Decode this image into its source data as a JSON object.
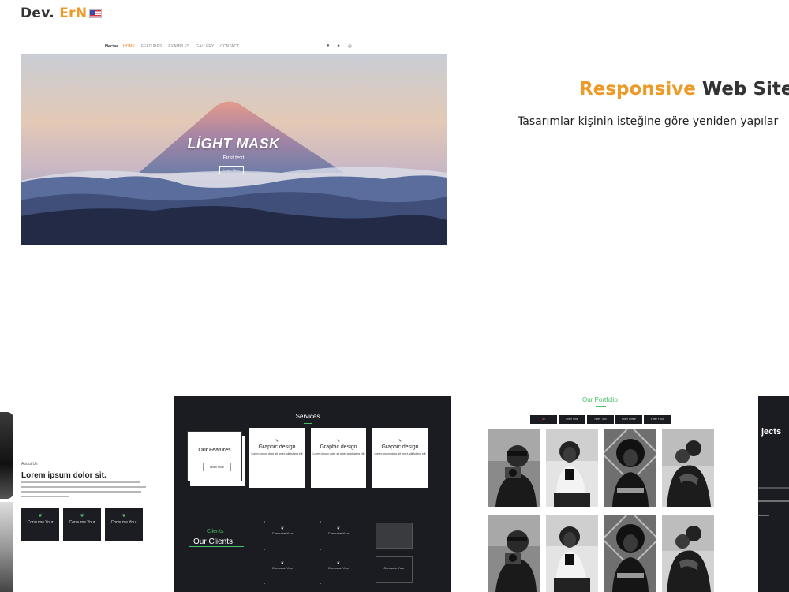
{
  "brand": {
    "prefix": "Dev.",
    "accent": "ErN"
  },
  "language_flag": "us-flag-icon",
  "hero_preview": {
    "nav_brand": "Nectar",
    "nav_items": [
      "HOME",
      "FEATURES",
      "EXAMPLES",
      "GALLERY",
      "CONTACT"
    ],
    "social_icons": [
      "facebook-icon",
      "twitter-icon",
      "instagram-icon"
    ],
    "social_glyphs": [
      "●",
      "✦",
      "◎"
    ],
    "title": "LİGHT MASK",
    "subtitle": "First text",
    "button": "Learn More"
  },
  "headline": {
    "accent": "Responsive",
    "rest": "Web Sitesi",
    "subtitle": "Tasarımlar kişinin isteğine göre yeniden yapılar"
  },
  "about_preview": {
    "small": "About Us",
    "title": "Lorem ipsum dolor sit.",
    "boxes": [
      {
        "icon": "leaf-icon",
        "glyph": "❦",
        "label": "Consume Your"
      },
      {
        "icon": "leaf-icon",
        "glyph": "❦",
        "label": "Consume Your"
      },
      {
        "icon": "leaf-icon",
        "glyph": "❦",
        "label": "Consume Your"
      }
    ]
  },
  "services_preview": {
    "title": "Services",
    "feature_card": {
      "title": "Our Features",
      "button": "Learn More"
    },
    "cards": [
      {
        "icon": "pencil-icon",
        "glyph": "✎",
        "title": "Graphic design",
        "text": "Lorem ipsum dolor sit amet adipisicing elit"
      },
      {
        "icon": "pencil-icon",
        "glyph": "✎",
        "title": "Graphic design",
        "text": "Lorem ipsum dolor sit amet adipisicing elit"
      },
      {
        "icon": "pencil-icon",
        "glyph": "✎",
        "title": "Graphic design",
        "text": "Lorem ipsum dolor sit amet adipisicing elit"
      }
    ],
    "clients_small": "Clients",
    "clients_title": "Our Clients",
    "client_items": [
      {
        "glyph": "❦",
        "label": "Consume Your"
      },
      {
        "glyph": "❦",
        "label": "Consume Your"
      },
      {
        "glyph": "❦",
        "label": "Consume Your"
      },
      {
        "glyph": "❦",
        "label": "Consume Your"
      }
    ],
    "client_box_label": "Consume Your"
  },
  "portfolio_preview": {
    "title": "Our Portfolio",
    "tabs": [
      "All",
      "Filter One",
      "Filter Two",
      "Filter Three",
      "Filter Four"
    ]
  },
  "projects_preview": {
    "title": "jects"
  }
}
